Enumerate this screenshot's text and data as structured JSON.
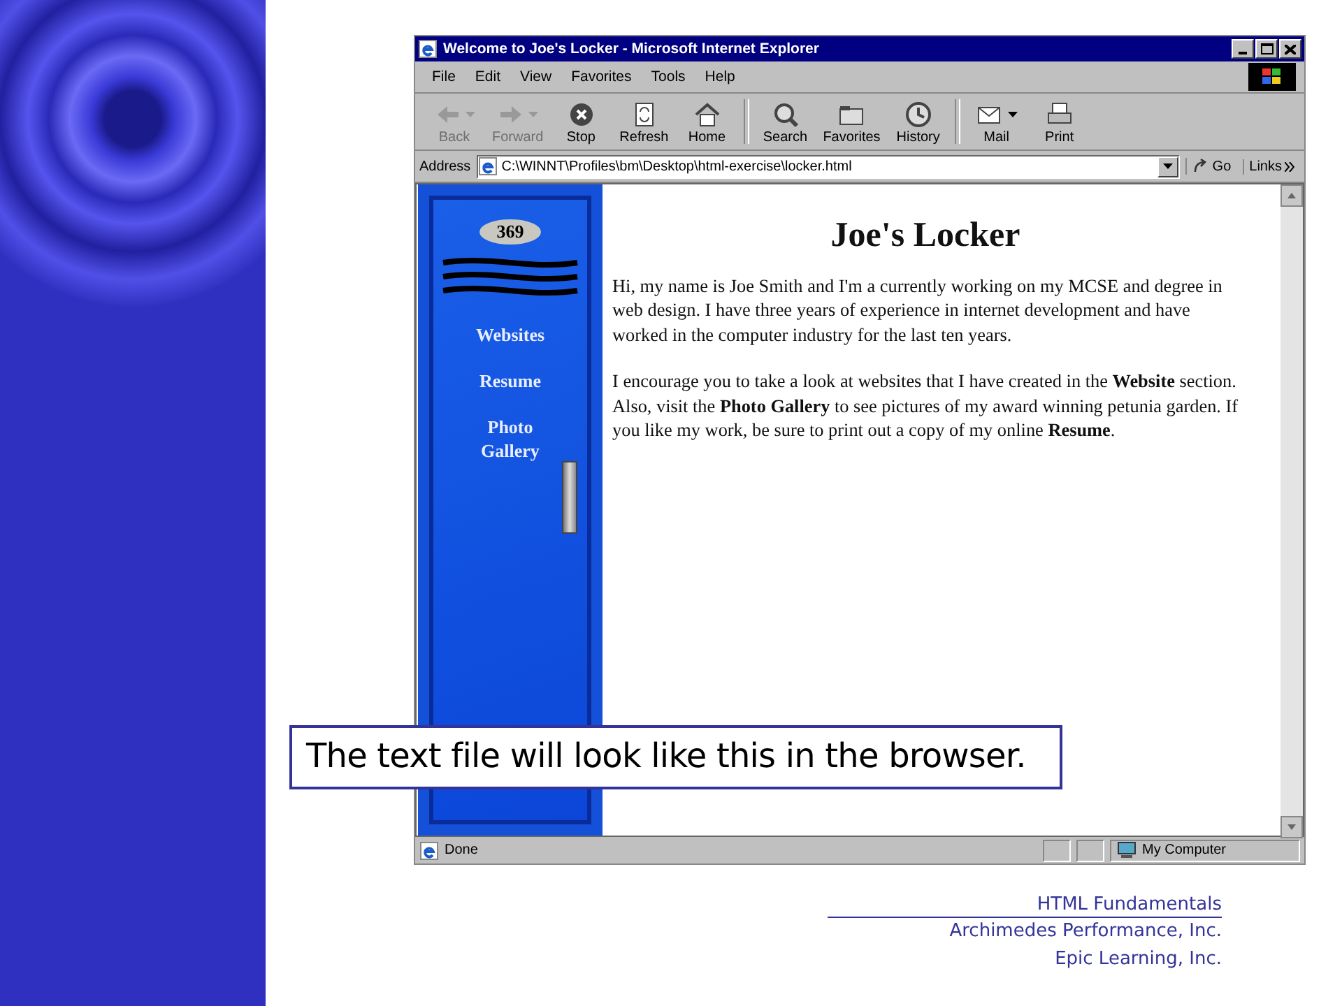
{
  "window": {
    "title": "Welcome to Joe's Locker - Microsoft Internet Explorer"
  },
  "menu": [
    {
      "label": "File"
    },
    {
      "label": "Edit"
    },
    {
      "label": "View"
    },
    {
      "label": "Favorites"
    },
    {
      "label": "Tools"
    },
    {
      "label": "Help"
    }
  ],
  "toolbar": [
    {
      "kind": "back",
      "label": "Back",
      "disabled": true,
      "dropdown": true
    },
    {
      "kind": "forward",
      "label": "Forward",
      "disabled": true,
      "dropdown": true
    },
    {
      "kind": "stop",
      "label": "Stop",
      "disabled": false,
      "dropdown": false
    },
    {
      "kind": "refresh",
      "label": "Refresh",
      "disabled": false,
      "dropdown": false
    },
    {
      "kind": "home",
      "label": "Home",
      "disabled": false,
      "dropdown": false
    },
    {
      "kind": "search",
      "label": "Search",
      "disabled": false,
      "dropdown": false
    },
    {
      "kind": "favorites",
      "label": "Favorites",
      "disabled": false,
      "dropdown": false
    },
    {
      "kind": "history",
      "label": "History",
      "disabled": false,
      "dropdown": false
    },
    {
      "kind": "mail",
      "label": "Mail",
      "disabled": false,
      "dropdown": true
    },
    {
      "kind": "print",
      "label": "Print",
      "disabled": false,
      "dropdown": false
    }
  ],
  "address": {
    "label": "Address",
    "value": "C:\\WINNT\\Profiles\\bm\\Desktop\\html-exercise\\locker.html",
    "go": "Go",
    "links": "Links"
  },
  "page": {
    "locker_number": "369",
    "nav": [
      "Websites",
      "Resume",
      "Photo Gallery"
    ],
    "heading": "Joe's Locker",
    "paragraphs": [
      "Hi, my name is Joe Smith and I'm a currently working on my MCSE and degree in web design. I have three years of experience in internet development and have worked in the computer industry for the last ten years.",
      "I encourage you to take a look at websites that I have created in the **Website** section. Also, visit the **Photo Gallery** to see pictures of my award winning petunia garden. If you like my work, be sure to print out a copy of my online **Resume**."
    ]
  },
  "status_bar": {
    "text": "Done",
    "zone": "My Computer"
  },
  "callout": "The text file will look like this in the browser.",
  "footer": {
    "title": "HTML Fundamentals",
    "lines": [
      "Archimedes Performance, Inc.",
      "Epic Learning, Inc."
    ]
  }
}
